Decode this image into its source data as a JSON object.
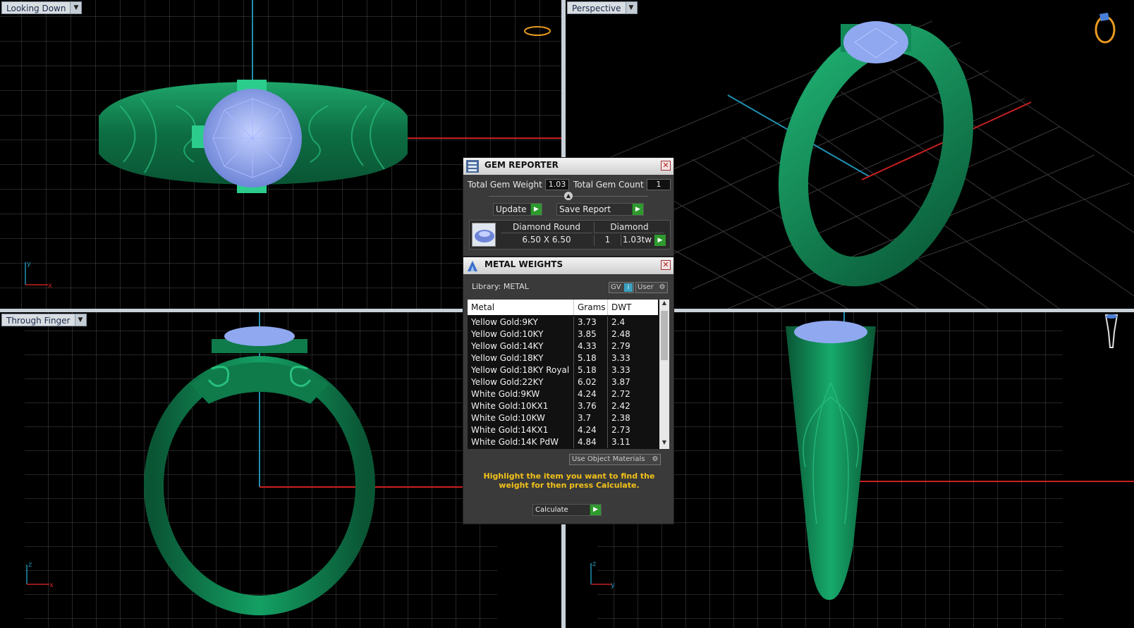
{
  "viewports": {
    "top_left": {
      "label": "Looking Down",
      "axis_v": "y",
      "axis_h": "x"
    },
    "top_right": {
      "label": "Perspective"
    },
    "bottom_left": {
      "label": "Through Finger",
      "axis_v": "z",
      "axis_h": "x"
    },
    "bottom_right": {
      "axis_v": "z",
      "axis_h": "y"
    }
  },
  "gem_reporter": {
    "title": "GEM REPORTER",
    "total_weight_label": "Total Gem Weight",
    "total_weight_value": "1.03",
    "total_count_label": "Total Gem Count",
    "total_count_value": "1",
    "update_label": "Update",
    "save_label": "Save Report",
    "gem": {
      "name": "Diamond Round",
      "type": "Diamond",
      "size": "6.50 X 6.50",
      "count": "1",
      "weight": "1.03tw"
    }
  },
  "metal_weights": {
    "title": "METAL WEIGHTS",
    "library_label": "Library: METAL",
    "gv_label": "GV",
    "user_label": "User",
    "columns": [
      "Metal",
      "Grams",
      "DWT"
    ],
    "rows": [
      {
        "metal": "Yellow Gold:9KY",
        "grams": "3.73",
        "dwt": "2.4"
      },
      {
        "metal": "Yellow Gold:10KY",
        "grams": "3.85",
        "dwt": "2.48"
      },
      {
        "metal": "Yellow Gold:14KY",
        "grams": "4.33",
        "dwt": "2.79"
      },
      {
        "metal": "Yellow Gold:18KY",
        "grams": "5.18",
        "dwt": "3.33"
      },
      {
        "metal": "Yellow Gold:18KY Royal",
        "grams": "5.18",
        "dwt": "3.33"
      },
      {
        "metal": "Yellow Gold:22KY",
        "grams": "6.02",
        "dwt": "3.87"
      },
      {
        "metal": "White Gold:9KW",
        "grams": "4.24",
        "dwt": "2.72"
      },
      {
        "metal": "White Gold:10KX1",
        "grams": "3.76",
        "dwt": "2.42"
      },
      {
        "metal": "White Gold:10KW",
        "grams": "3.7",
        "dwt": "2.38"
      },
      {
        "metal": "White Gold:14KX1",
        "grams": "4.24",
        "dwt": "2.73"
      },
      {
        "metal": "White Gold:14K PdW",
        "grams": "4.84",
        "dwt": "3.11"
      }
    ],
    "use_object_materials_label": "Use Object Materials",
    "hint": "Highlight the item you want to find the weight for then press Calculate.",
    "calculate_label": "Calculate"
  },
  "colors": {
    "ring_green": "#0f7a4a",
    "gem_blue": "#8fa8f0",
    "grid": "#4a4a4a",
    "axis_red": "#c82020",
    "axis_blue": "#1f8fb0",
    "hint_yellow": "#f2c21a"
  }
}
